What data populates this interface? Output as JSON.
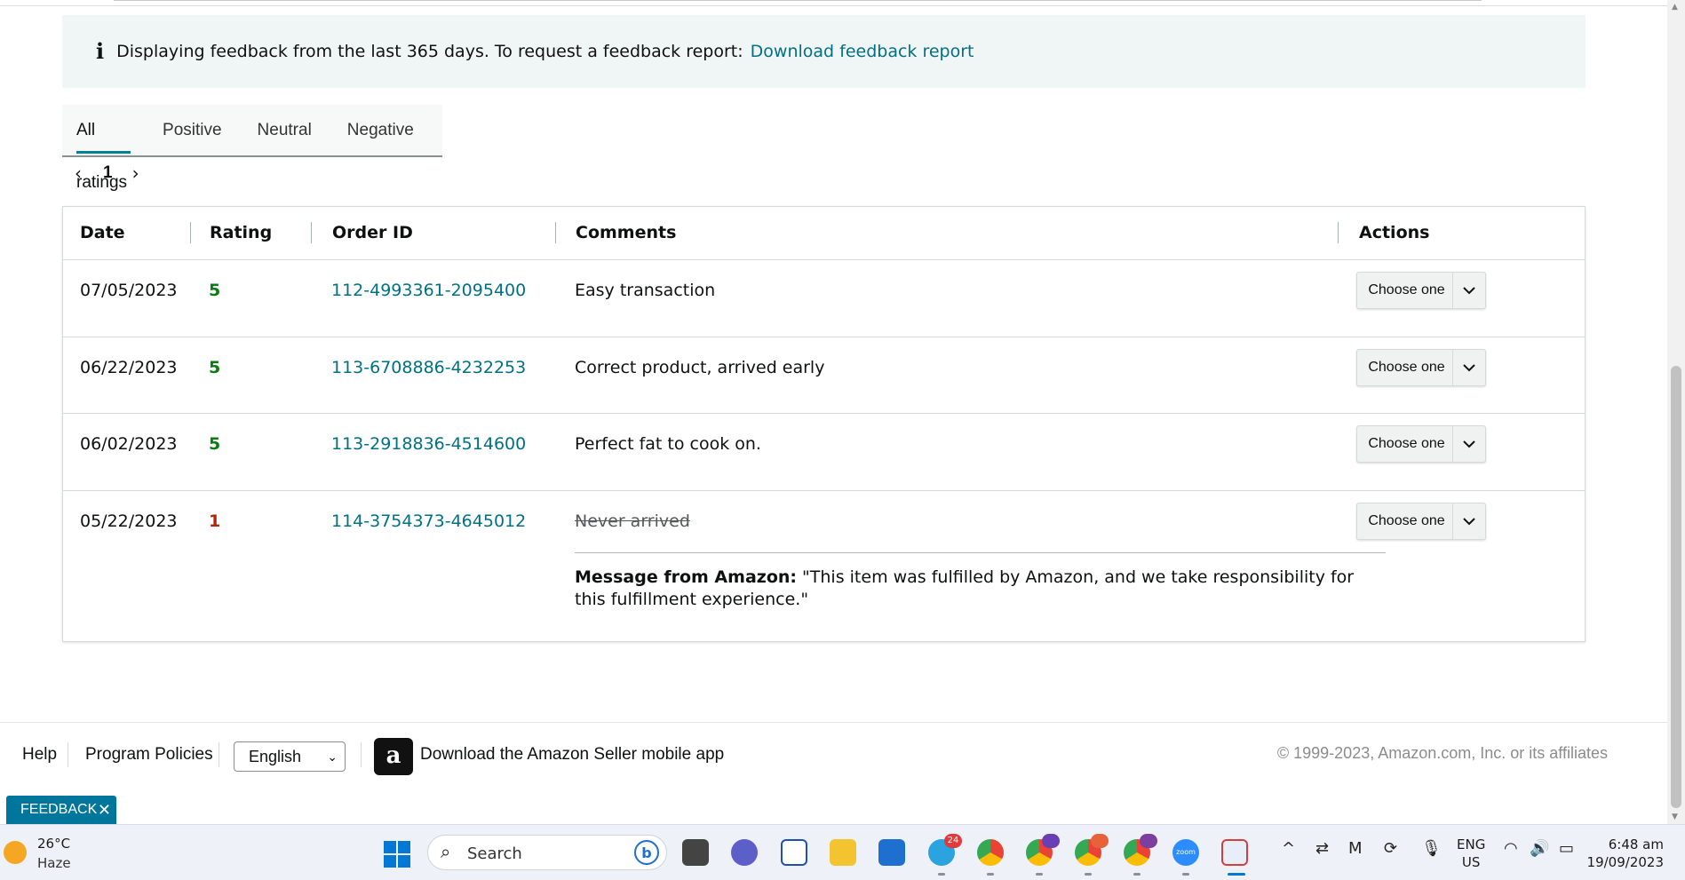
{
  "banner": {
    "text": "Displaying feedback from the last 365 days. To request a feedback report:",
    "link": "Download feedback report"
  },
  "tabs": [
    {
      "label": "All ratings",
      "active": true
    },
    {
      "label": "Positive",
      "active": false
    },
    {
      "label": "Neutral",
      "active": false
    },
    {
      "label": "Negative",
      "active": false
    }
  ],
  "pager": {
    "current_page": "1"
  },
  "table": {
    "headers": {
      "date": "Date",
      "rating": "Rating",
      "order_id": "Order ID",
      "comments": "Comments",
      "actions": "Actions"
    },
    "rows": [
      {
        "date": "07/05/2023",
        "rating": "5",
        "order_id": "112-4993361-2095400",
        "comment": "Easy transaction",
        "action": "Choose one"
      },
      {
        "date": "06/22/2023",
        "rating": "5",
        "order_id": "113-6708886-4232253",
        "comment": "Correct product, arrived early",
        "action": "Choose one"
      },
      {
        "date": "06/02/2023",
        "rating": "5",
        "order_id": "113-2918836-4514600",
        "comment": "Perfect fat to cook on.",
        "action": "Choose one"
      },
      {
        "date": "05/22/2023",
        "rating": "1",
        "order_id": "114-3754373-4645012",
        "comment": "Never arrived",
        "action": "Choose one",
        "message_label": "Message from Amazon:",
        "message_text": "\"This item was fulfilled by Amazon, and we take responsibility for this fulfillment experience.\""
      }
    ]
  },
  "footer": {
    "help": "Help",
    "program_policies": "Program Policies",
    "language": "English",
    "app_logo_letter": "a",
    "app_download": "Download the Amazon Seller mobile app",
    "copyright": "© 1999-2023, Amazon.com, Inc. or its affiliates"
  },
  "feedback_tab": {
    "label": "FEEDBACK",
    "close": "✕"
  },
  "taskbar": {
    "weather_temp": "26°C",
    "weather_desc": "Haze",
    "search_placeholder": "Search",
    "telegram_badge": "24",
    "chrome_badge_1": "",
    "chrome_badge_2": "",
    "chrome_badge_3": "",
    "zoom_label": "zoom",
    "lang_top": "ENG",
    "lang_bottom": "US",
    "time": "6:48 am",
    "date": "19/09/2023"
  },
  "colors": {
    "link": "#007185",
    "positive_rating": "#067d0e",
    "negative_rating": "#b12704",
    "tab_underline": "#008296",
    "feedback_tab": "#00769c"
  }
}
